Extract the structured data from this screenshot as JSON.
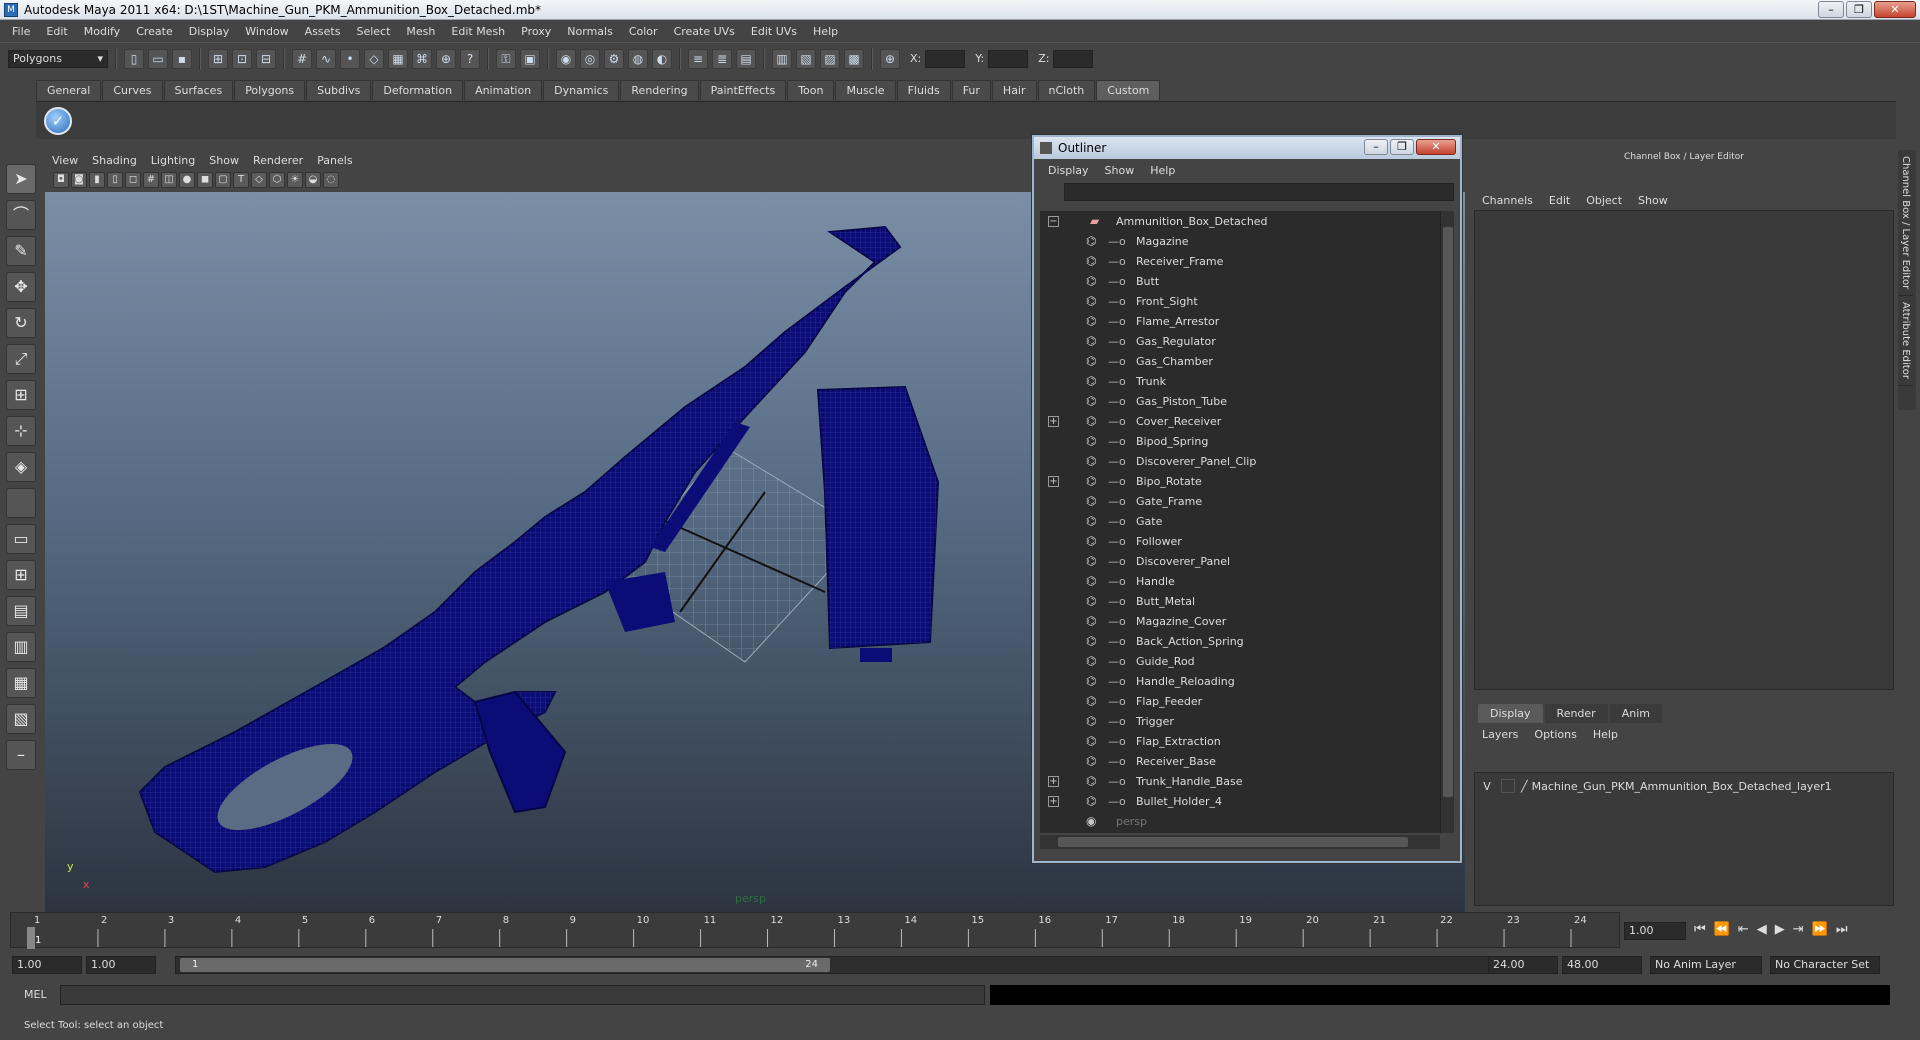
{
  "window": {
    "title": "Autodesk Maya 2011 x64: D:\\1ST\\Machine_Gun_PKM_Ammunition_Box_Detached.mb*"
  },
  "menubar": [
    "File",
    "Edit",
    "Modify",
    "Create",
    "Display",
    "Window",
    "Assets",
    "Select",
    "Mesh",
    "Edit Mesh",
    "Proxy",
    "Normals",
    "Color",
    "Create UVs",
    "Edit UVs",
    "Help"
  ],
  "statusline": {
    "mode": "Polygons",
    "x_label": "X:",
    "y_label": "Y:",
    "z_label": "Z:"
  },
  "shelf_tabs": [
    "General",
    "Curves",
    "Surfaces",
    "Polygons",
    "Subdivs",
    "Deformation",
    "Animation",
    "Dynamics",
    "Rendering",
    "PaintEffects",
    "Toon",
    "Muscle",
    "Fluids",
    "Fur",
    "Hair",
    "nCloth",
    "Custom"
  ],
  "shelf_active": "Custom",
  "viewport": {
    "menu": [
      "View",
      "Shading",
      "Lighting",
      "Show",
      "Renderer",
      "Panels"
    ],
    "camera_label": "persp",
    "axis_y": "y",
    "axis_x": "x"
  },
  "outliner": {
    "title": "Outliner",
    "menu": [
      "Display",
      "Show",
      "Help"
    ],
    "root": "Ammunition_Box_Detached",
    "items": [
      {
        "label": "Magazine",
        "expandable": false
      },
      {
        "label": "Receiver_Frame",
        "expandable": false
      },
      {
        "label": "Butt",
        "expandable": false
      },
      {
        "label": "Front_Sight",
        "expandable": false
      },
      {
        "label": "Flame_Arrestor",
        "expandable": false
      },
      {
        "label": "Gas_Regulator",
        "expandable": false
      },
      {
        "label": "Gas_Chamber",
        "expandable": false
      },
      {
        "label": "Trunk",
        "expandable": false
      },
      {
        "label": "Gas_Piston_Tube",
        "expandable": false
      },
      {
        "label": "Cover_Receiver",
        "expandable": true
      },
      {
        "label": "Bipod_Spring",
        "expandable": false
      },
      {
        "label": "Discoverer_Panel_Clip",
        "expandable": false
      },
      {
        "label": "Bipo_Rotate",
        "expandable": true
      },
      {
        "label": "Gate_Frame",
        "expandable": false
      },
      {
        "label": "Gate",
        "expandable": false
      },
      {
        "label": "Follower",
        "expandable": false
      },
      {
        "label": "Discoverer_Panel",
        "expandable": false
      },
      {
        "label": "Handle",
        "expandable": false
      },
      {
        "label": "Butt_Metal",
        "expandable": false
      },
      {
        "label": "Magazine_Cover",
        "expandable": false
      },
      {
        "label": "Back_Action_Spring",
        "expandable": false
      },
      {
        "label": "Guide_Rod",
        "expandable": false
      },
      {
        "label": "Handle_Reloading",
        "expandable": false
      },
      {
        "label": "Flap_Feeder",
        "expandable": false
      },
      {
        "label": "Trigger",
        "expandable": false
      },
      {
        "label": "Flap_Extraction",
        "expandable": false
      },
      {
        "label": "Receiver_Base",
        "expandable": false
      },
      {
        "label": "Trunk_Handle_Base",
        "expandable": true
      },
      {
        "label": "Bullet_Holder_4",
        "expandable": true
      }
    ],
    "camera_item": "persp"
  },
  "channel_box": {
    "header": "Channel Box / Layer Editor",
    "menu": [
      "Channels",
      "Edit",
      "Object",
      "Show"
    ],
    "side_tabs": [
      "Channel Box / Layer Editor",
      "Attribute Editor"
    ]
  },
  "layer_editor": {
    "tabs": [
      "Display",
      "Render",
      "Anim"
    ],
    "active_tab": "Display",
    "menu": [
      "Layers",
      "Options",
      "Help"
    ],
    "layer": {
      "visibility": "V",
      "name": "Machine_Gun_PKM_Ammunition_Box_Detached_layer1"
    }
  },
  "timeline": {
    "ticks": [
      "1",
      "2",
      "3",
      "4",
      "5",
      "6",
      "7",
      "8",
      "9",
      "10",
      "11",
      "12",
      "13",
      "14",
      "15",
      "16",
      "17",
      "18",
      "19",
      "20",
      "21",
      "22",
      "23",
      "24"
    ],
    "current_frame": "1",
    "current_time_field": "1.00",
    "range_start": "1.00",
    "range_start2": "1.00",
    "range_thumb_start": "1",
    "range_thumb_end": "24",
    "range_end": "24.00",
    "range_end2": "48.00",
    "anim_layer": "No Anim Layer",
    "character_set": "No Character Set"
  },
  "command_line": {
    "label": "MEL"
  },
  "help_line": "Select Tool: select an object"
}
